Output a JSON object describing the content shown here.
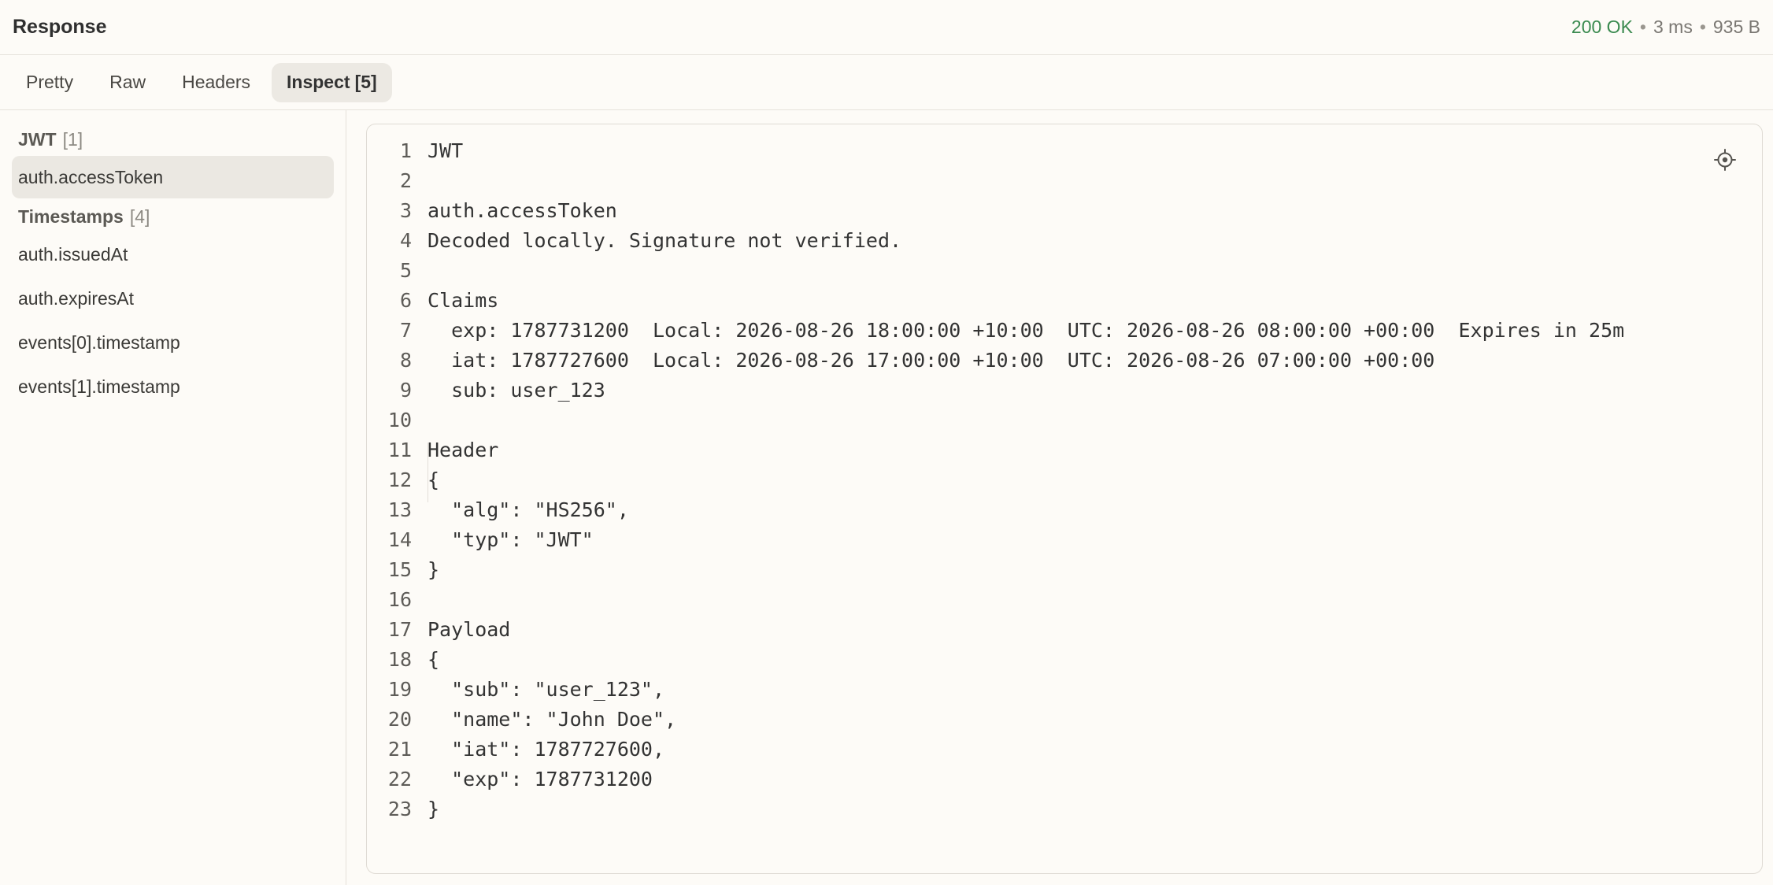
{
  "header": {
    "title": "Response",
    "status_code": "200 OK",
    "separator": "•",
    "time": "3 ms",
    "size": "935 B"
  },
  "tabs": [
    {
      "label": "Pretty",
      "count": "",
      "active": false
    },
    {
      "label": "Raw",
      "count": "",
      "active": false
    },
    {
      "label": "Headers",
      "count": "",
      "active": false
    },
    {
      "label": "Inspect",
      "count": "[5]",
      "active": true
    }
  ],
  "sidebar": {
    "groups": [
      {
        "title": "JWT",
        "count": "[1]",
        "items": [
          {
            "label": "auth.accessToken",
            "selected": true
          }
        ]
      },
      {
        "title": "Timestamps",
        "count": "[4]",
        "items": [
          {
            "label": "auth.issuedAt",
            "selected": false
          },
          {
            "label": "auth.expiresAt",
            "selected": false
          },
          {
            "label": "events[0].timestamp",
            "selected": false
          },
          {
            "label": "events[1].timestamp",
            "selected": false
          }
        ]
      }
    ]
  },
  "editor": {
    "locate_icon": "crosshair-icon",
    "lines": [
      {
        "n": "1",
        "text": "JWT"
      },
      {
        "n": "2",
        "text": ""
      },
      {
        "n": "3",
        "text": "auth.accessToken"
      },
      {
        "n": "4",
        "text": "Decoded locally. Signature not verified."
      },
      {
        "n": "5",
        "text": ""
      },
      {
        "n": "6",
        "text": "Claims"
      },
      {
        "n": "7",
        "text": "  exp: 1787731200  Local: 2026-08-26 18:00:00 +10:00  UTC: 2026-08-26 08:00:00 +00:00  Expires in 25m"
      },
      {
        "n": "8",
        "text": "  iat: 1787727600  Local: 2026-08-26 17:00:00 +10:00  UTC: 2026-08-26 07:00:00 +00:00"
      },
      {
        "n": "9",
        "text": "  sub: user_123"
      },
      {
        "n": "10",
        "text": ""
      },
      {
        "n": "11",
        "text": "Header"
      },
      {
        "n": "12",
        "text": "{"
      },
      {
        "n": "13",
        "text": "  \"alg\": \"HS256\","
      },
      {
        "n": "14",
        "text": "  \"typ\": \"JWT\""
      },
      {
        "n": "15",
        "text": "}"
      },
      {
        "n": "16",
        "text": ""
      },
      {
        "n": "17",
        "text": "Payload"
      },
      {
        "n": "18",
        "text": "{"
      },
      {
        "n": "19",
        "text": "  \"sub\": \"user_123\","
      },
      {
        "n": "20",
        "text": "  \"name\": \"John Doe\","
      },
      {
        "n": "21",
        "text": "  \"iat\": 1787727600,"
      },
      {
        "n": "22",
        "text": "  \"exp\": 1787731200"
      },
      {
        "n": "23",
        "text": "}"
      }
    ]
  }
}
